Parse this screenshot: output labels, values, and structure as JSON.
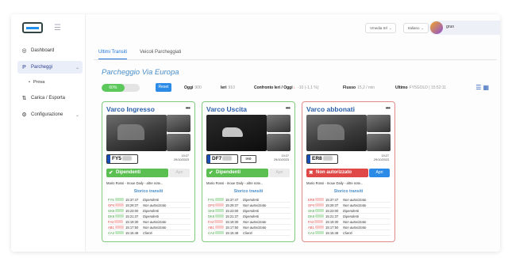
{
  "sidebar": {
    "items": [
      {
        "label": "Dashboard",
        "icon": "dashboard-icon"
      },
      {
        "label": "Parcheggi",
        "icon": "parking-icon",
        "active": true,
        "sub": [
          "Prova"
        ]
      },
      {
        "label": "Carica / Esporta",
        "icon": "upload-icon"
      },
      {
        "label": "Configurazione",
        "icon": "gear-icon"
      }
    ]
  },
  "topbar": {
    "select1": "Vmedia Srl",
    "select2": "Italiano",
    "user": "gruo"
  },
  "tabs": [
    {
      "label": "Ultimi Transiti",
      "active": true
    },
    {
      "label": "Veicoli Parcheggiati",
      "active": false
    }
  ],
  "page_title": "Parcheggio Via Europa",
  "stats": {
    "occupancy_percent": 60,
    "occupancy_label": "60%",
    "reset_label": "Reset",
    "oggi_label": "Oggi",
    "oggi_value": "900",
    "ieri_label": "Ieri",
    "ieri_value": "910",
    "confronto_label": "Confronto Ieri / Oggi",
    "confronto_value": "-10 (-1,1 %)",
    "flusso_label": "Flusso",
    "flusso_value": "15,2 / min",
    "ultimo_label": "Ultimo",
    "ultimo_value": "FY5GOLD | 15:52:11"
  },
  "cards": [
    {
      "title": "Varco Ingresso",
      "plate": "FY5",
      "plate2": "",
      "timestamp": [
        "19:27",
        "29/10/2023"
      ],
      "status": "Dipendenti",
      "status_kind": "ok",
      "open_label": "Apri",
      "tariff": "Mario Rossi - Inoue Daily - altre note...",
      "history_title": "Storico transiti",
      "history": [
        {
          "plate": "FY5",
          "time": "15:37:47",
          "desc": "Dipendenti",
          "kind": "g"
        },
        {
          "plate": "GP4",
          "time": "15:29:37",
          "desc": "Non autorizzato",
          "kind": "r"
        },
        {
          "plate": "GK6",
          "time": "15:23:00",
          "desc": "Dipendenti",
          "kind": "g"
        },
        {
          "plate": "DK6",
          "time": "15:21:37",
          "desc": "Dipendenti",
          "kind": "g"
        },
        {
          "plate": "FA2",
          "time": "15:19:30",
          "desc": "Non autorizzato",
          "kind": "r"
        },
        {
          "plate": "AB1",
          "time": "15:17:50",
          "desc": "Non autorizzato",
          "kind": "r"
        },
        {
          "plate": "CA2",
          "time": "15:15:48",
          "desc": "Clienti",
          "kind": "g"
        }
      ]
    },
    {
      "title": "Varco Uscita",
      "plate": "DF7",
      "plate2": "IA0",
      "timestamp": [
        "19:27",
        "29/10/2023"
      ],
      "status": "Dipendenti",
      "status_kind": "ok",
      "open_label": "Apri",
      "tariff": "Mario Rossi - Inoue Daily - altre note...",
      "history_title": "Storico transiti",
      "history": [
        {
          "plate": "FY5",
          "time": "15:37:47",
          "desc": "Dipendenti",
          "kind": "g"
        },
        {
          "plate": "GP4",
          "time": "15:29:37",
          "desc": "Non autorizzato",
          "kind": "r"
        },
        {
          "plate": "GK6",
          "time": "15:23:00",
          "desc": "Dipendenti",
          "kind": "g"
        },
        {
          "plate": "DK6",
          "time": "15:21:37",
          "desc": "Dipendenti",
          "kind": "g"
        },
        {
          "plate": "FA2",
          "time": "15:19:30",
          "desc": "Non autorizzato",
          "kind": "r"
        },
        {
          "plate": "AB1",
          "time": "15:17:50",
          "desc": "Non autorizzato",
          "kind": "r"
        },
        {
          "plate": "CA2",
          "time": "15:15:48",
          "desc": "Clienti",
          "kind": "g"
        }
      ]
    },
    {
      "title": "Varco abbonati",
      "plate": "ER8",
      "plate2": "",
      "timestamp": [
        "19:27",
        "29/10/2023"
      ],
      "status": "Non autorizzato",
      "status_kind": "ko",
      "open_label": "Apri",
      "tariff": "Mario Rossi - Inoue Daily - altre note...",
      "history_title": "Storico transiti",
      "history": [
        {
          "plate": "ER8",
          "time": "15:37:47",
          "desc": "Non autorizzato",
          "kind": "r"
        },
        {
          "plate": "GP4",
          "time": "15:29:37",
          "desc": "Non autorizzato",
          "kind": "r"
        },
        {
          "plate": "GK6",
          "time": "15:23:00",
          "desc": "Dipendenti",
          "kind": "g"
        },
        {
          "plate": "DK6",
          "time": "15:21:37",
          "desc": "Dipendenti",
          "kind": "g"
        },
        {
          "plate": "FA2",
          "time": "15:19:30",
          "desc": "Non autorizzato",
          "kind": "r"
        },
        {
          "plate": "AB1",
          "time": "15:17:50",
          "desc": "Non autorizzato",
          "kind": "r"
        },
        {
          "plate": "CA2",
          "time": "15:15:48",
          "desc": "Clienti",
          "kind": "g"
        }
      ]
    }
  ]
}
